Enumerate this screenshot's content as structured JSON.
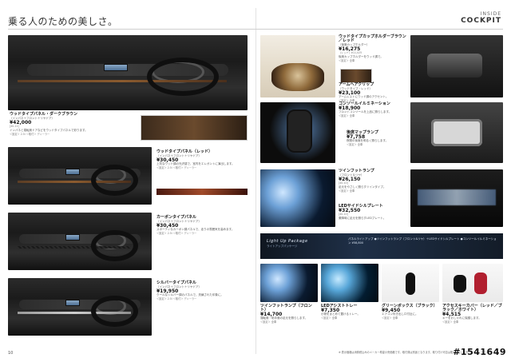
{
  "header": {
    "left_title": "乗る人のための美しさ。",
    "right_small": "INSIDE",
    "right_big": "COCKPIT"
  },
  "left": {
    "items": [
      {
        "caption": "ウッドタイプパネル・ダークブラウン",
        "sub": "（インパネ＋フロント＋リヤドア）",
        "price": "¥42,000",
        "price_note": "[40-11]",
        "desc": "インパネと運転席ドアなどをウッドタイプパネルで彩ります。",
        "note": "＜設定＞ 2.5i  ＜取付＞ ディーラー"
      },
      {
        "caption": "ウッドタイプパネル（レッド）",
        "sub": "（インパネ＋フロント＋リヤドア）",
        "price": "¥30,450",
        "price_note": "",
        "desc": "上質なウッド調の光沢感で、室内をエレガントに演出します。",
        "note": "＜設定＞ 2.5i  ＜取付＞ ディーラー"
      },
      {
        "caption": "カーボンタイプパネル",
        "sub": "（インパネ＋フロント＋リヤドア）",
        "price": "¥30,450",
        "price_note": "",
        "desc": "スポーティなカーボン調パネルで、走りの雰囲気を高めます。",
        "note": "＜設定＞ 2.5i  ＜取付＞ ディーラー"
      },
      {
        "caption": "シルバータイプパネル",
        "sub": "（インパネ＋フロント＋リヤドア）",
        "price": "¥19,950",
        "price_note": "",
        "desc": "クールなシルバー調のパネルで、洗練された印象に。",
        "note": "＜設定＞ 2.5i  ＜取付＞ ディーラー"
      }
    ],
    "pagenum": "10"
  },
  "right": {
    "top": [
      {
        "title": "ウッドタイプカップホルダーブラウン／レッド",
        "sub": "（後席カップホルダー）",
        "price": "¥16,275",
        "price_note": "（レッド）¥11,025",
        "desc": "後席カップホルダーをウッド調で。",
        "note": "＜設定＞ 全車"
      },
      {
        "title": "アームヘアクリップ",
        "sub": "（ウッドタイプ・レッド）",
        "price": "¥23,100",
        "price_note": "",
        "desc": "アームレストにウッド調のアクセント。",
        "note": "＜設定＞ 全車"
      }
    ],
    "mid": [
      {
        "title": "コンソールイルミネーション",
        "price": "¥18,900",
        "price_note": "",
        "desc": "フロントコンソールを上品に照らします。",
        "note": "＜設定＞ 全車"
      },
      {
        "title": "後席マップランプ",
        "price": "¥7,758",
        "price_note": "",
        "desc": "夜間の後席を明るく照らします。",
        "note": "＜設定＞ 全車"
      },
      {
        "title": "ツインフットランプ",
        "sub": "（フロント＆リヤ）",
        "price": "¥26,150",
        "price_note": "[40-10]",
        "desc": "足元をやさしく照らすツインタイプ。",
        "note": "＜設定＞ 全車"
      },
      {
        "title": "LEDサイドシルプレート",
        "price": "¥32,550",
        "price_note": "[40-10]",
        "desc": "乗降時に足元を照らすLEDプレート。",
        "note": "＜設定＞ 全車"
      }
    ],
    "banner": {
      "title": "Light Up Package",
      "subtitle": "ライトアップパッケージ",
      "text": "パネルライトアップ  ●ツインフットランプ（フロント&リヤ）＋LEDサイドシルプレート  ●コンソールイルミネーション  ¥58,800"
    },
    "bottom": [
      {
        "title": "ツインフットランプ（フロント）",
        "price": "¥14,700",
        "desc": "運転席・助手席の足元を照らします。",
        "note": "＜設定＞ 全車"
      },
      {
        "title": "LEDアシストトレー",
        "price": "¥7,350",
        "desc": "小物をまとめて置けるトレー。",
        "note": "＜設定＞ 全車"
      },
      {
        "title": "グリーンボックス（ブラック）",
        "price": "¥9,450",
        "desc": "エアコン吹き出し口付近に。",
        "note": "＜設定＞ 全車"
      },
      {
        "title": "アクセスキーカバー（レッド／ブラック／ホワイト）",
        "price": "¥4,515",
        "desc": "キーをおしゃれに保護します。",
        "note": "＜設定＞ 全車"
      }
    ],
    "footnote": "※ 表示価格は消費税込みのメーカー希望小売価格です。取付費は別途となります。取り付け可否は販売会社にお問い合わせください。"
  },
  "watermark": "#1541649"
}
